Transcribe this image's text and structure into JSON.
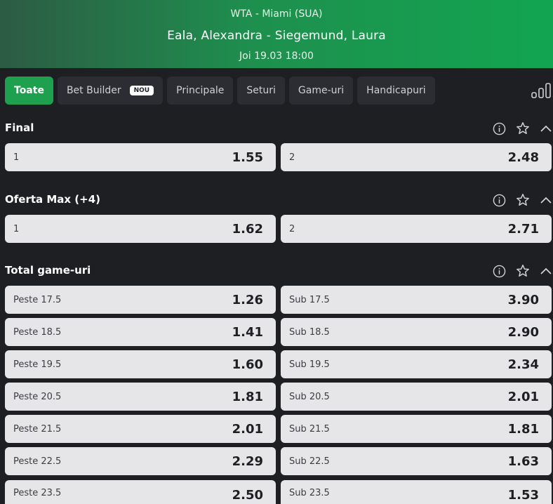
{
  "header": {
    "league": "WTA -  Miami (SUA)",
    "match": "Eala, Alexandra - Siegemund, Laura",
    "datetime": "Joi 19.03 18:00"
  },
  "tabs": [
    {
      "label": "Toate",
      "active": true
    },
    {
      "label": "Bet Builder",
      "badge": "NOU"
    },
    {
      "label": "Principale"
    },
    {
      "label": "Seturi"
    },
    {
      "label": "Game-uri"
    },
    {
      "label": "Handicapuri"
    }
  ],
  "sections": [
    {
      "title": "Final",
      "rows": [
        [
          {
            "label": "1",
            "odd": "1.55"
          },
          {
            "label": "2",
            "odd": "2.48"
          }
        ]
      ]
    },
    {
      "title": "Oferta Max (+4)",
      "rows": [
        [
          {
            "label": "1",
            "odd": "1.62"
          },
          {
            "label": "2",
            "odd": "2.71"
          }
        ]
      ]
    },
    {
      "title": "Total game-uri",
      "rows": [
        [
          {
            "label": "Peste 17.5",
            "odd": "1.26"
          },
          {
            "label": "Sub 17.5",
            "odd": "3.90"
          }
        ],
        [
          {
            "label": "Peste 18.5",
            "odd": "1.41"
          },
          {
            "label": "Sub 18.5",
            "odd": "2.90"
          }
        ],
        [
          {
            "label": "Peste 19.5",
            "odd": "1.60"
          },
          {
            "label": "Sub 19.5",
            "odd": "2.34"
          }
        ],
        [
          {
            "label": "Peste 20.5",
            "odd": "1.81"
          },
          {
            "label": "Sub 20.5",
            "odd": "2.01"
          }
        ],
        [
          {
            "label": "Peste 21.5",
            "odd": "2.01"
          },
          {
            "label": "Sub 21.5",
            "odd": "1.81"
          }
        ],
        [
          {
            "label": "Peste 22.5",
            "odd": "2.29"
          },
          {
            "label": "Sub 22.5",
            "odd": "1.63"
          }
        ],
        [
          {
            "label": "Peste 23.5",
            "odd": "2.50"
          },
          {
            "label": "Sub 23.5",
            "odd": "1.53"
          }
        ]
      ]
    }
  ],
  "icons": {
    "stats": "bar-chart-icon",
    "info": "info-icon",
    "favorite": "star-icon",
    "collapse": "chevron-up-icon"
  },
  "colors": {
    "active_tab": "#1fa04f",
    "header_start": "#2d5b44",
    "header_end": "#12a551",
    "odd_bg": "#e6e6e9"
  }
}
